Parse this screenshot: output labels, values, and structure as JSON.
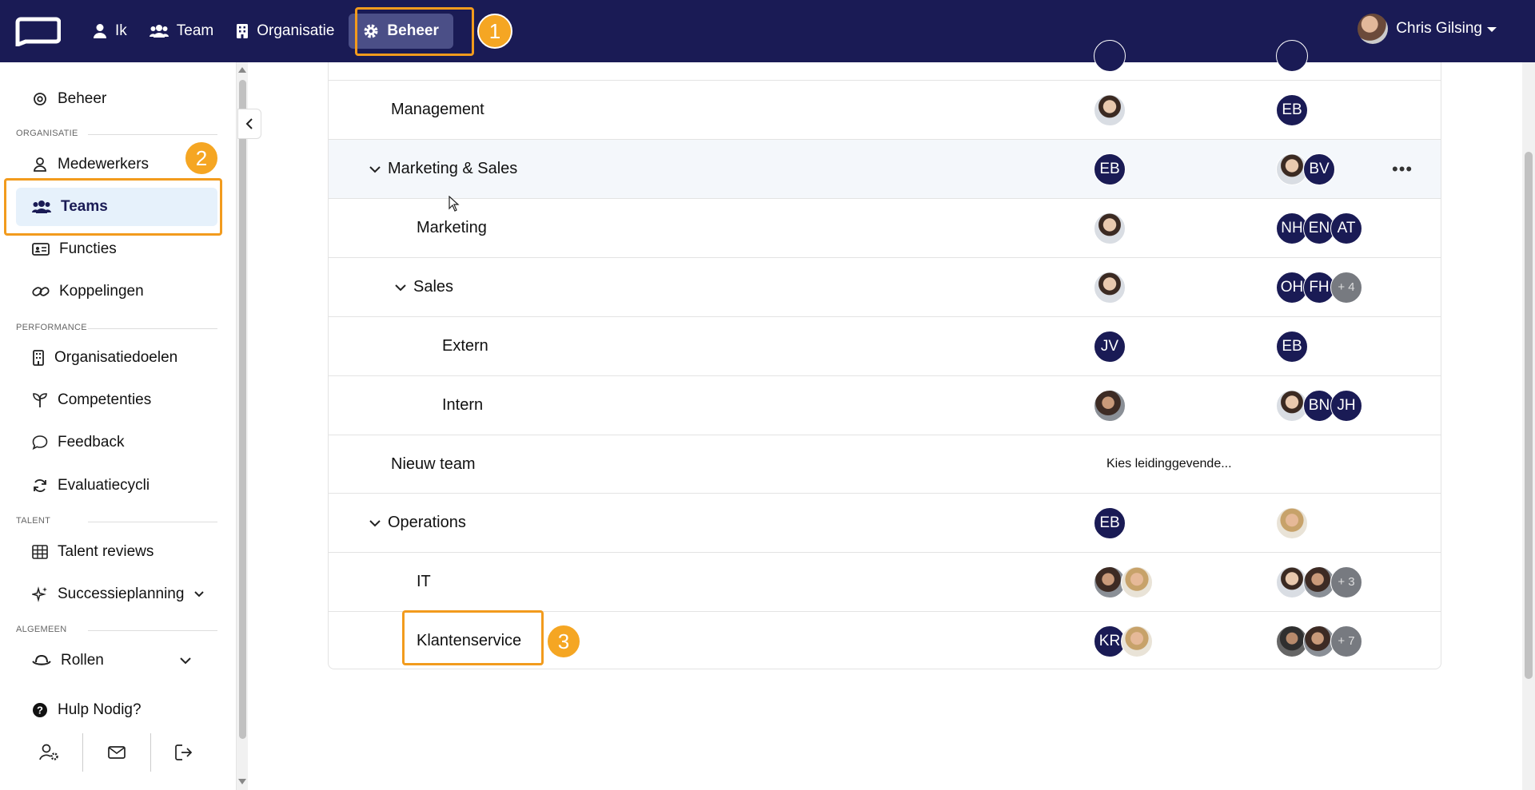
{
  "topnav": {
    "items": [
      {
        "label": "Ik",
        "icon": "user-icon"
      },
      {
        "label": "Team",
        "icon": "users-icon"
      },
      {
        "label": "Organisatie",
        "icon": "building-icon"
      },
      {
        "label": "Beheer",
        "icon": "gear-icon",
        "active": true
      }
    ],
    "user_name": "Chris Gilsing",
    "badge_1": "1"
  },
  "sidebar": {
    "beheer": "Beheer",
    "sections": {
      "organisatie": "ORGANISATIE",
      "performance": "PERFORMANCE",
      "talent": "TALENT",
      "algemeen": "ALGEMEEN"
    },
    "items": {
      "medewerkers": "Medewerkers",
      "teams": "Teams",
      "functies": "Functies",
      "koppelingen": "Koppelingen",
      "organisatiedoelen": "Organisatiedoelen",
      "competenties": "Competenties",
      "feedback": "Feedback",
      "evaluatiecycli": "Evaluatiecycli",
      "talent_reviews": "Talent reviews",
      "successieplanning": "Successieplanning",
      "rollen": "Rollen",
      "hulp": "Hulp Nodig?"
    },
    "badge_2": "2"
  },
  "teams": [
    {
      "name": "Management",
      "leads": [
        {
          "type": "photo-a"
        }
      ],
      "members": [
        {
          "initials": "EB"
        }
      ]
    },
    {
      "name": "Marketing & Sales",
      "expanded": true,
      "leads": [
        {
          "initials": "EB"
        }
      ],
      "members": [
        {
          "type": "photo-a"
        },
        {
          "initials": "BV"
        }
      ],
      "menu": "•••"
    },
    {
      "name": "Marketing",
      "leads": [
        {
          "type": "photo-a"
        }
      ],
      "members": [
        {
          "initials": "NH"
        },
        {
          "initials": "EN"
        },
        {
          "initials": "AT"
        }
      ]
    },
    {
      "name": "Sales",
      "expanded": true,
      "leads": [
        {
          "type": "photo-a"
        }
      ],
      "members": [
        {
          "initials": "OH"
        },
        {
          "initials": "FH"
        },
        {
          "more": "+ 4"
        }
      ]
    },
    {
      "name": "Extern",
      "leads": [
        {
          "initials": "JV"
        }
      ],
      "members": [
        {
          "initials": "EB"
        }
      ]
    },
    {
      "name": "Intern",
      "leads": [
        {
          "type": "photo-c"
        }
      ],
      "members": [
        {
          "type": "photo-a"
        },
        {
          "initials": "BN"
        },
        {
          "initials": "JH"
        }
      ]
    },
    {
      "name": "Nieuw team",
      "placeholder": "Kies leidinggevende..."
    },
    {
      "name": "Operations",
      "expanded": true,
      "leads": [
        {
          "initials": "EB"
        }
      ],
      "members": [
        {
          "type": "photo-b"
        }
      ]
    },
    {
      "name": "IT",
      "leads": [
        {
          "type": "photo-c"
        },
        {
          "type": "photo-b"
        }
      ],
      "members": [
        {
          "type": "photo-a"
        },
        {
          "type": "photo-c"
        },
        {
          "more": "+ 3"
        }
      ]
    },
    {
      "name": "Klantenservice",
      "leads": [
        {
          "initials": "KR"
        },
        {
          "type": "photo-b"
        }
      ],
      "members": [
        {
          "type": "photo-d"
        },
        {
          "type": "photo-c"
        },
        {
          "more": "+ 7"
        }
      ]
    }
  ],
  "badge_3": "3",
  "colors": {
    "nav_bg": "#1a1b55",
    "highlight": "#f29b1d",
    "active_bg": "#e6f1fb"
  }
}
